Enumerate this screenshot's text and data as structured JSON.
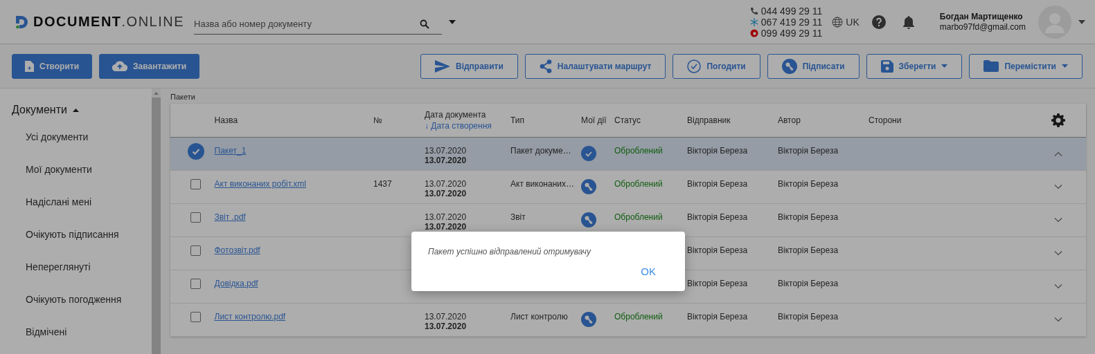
{
  "header": {
    "logo": {
      "bold": "DOCUMENT",
      "light": ".ONLINE"
    },
    "search": {
      "placeholder": "Назва або номер документу"
    },
    "phones": [
      "044 499 29 11",
      "067 419 29 11",
      "099 499 29 11"
    ],
    "language": "UK",
    "user": {
      "name": "Богдан Мартищенко",
      "email": "marbo97fd@gmail.com"
    }
  },
  "toolbar": {
    "buttons": [
      {
        "label": "Створити",
        "kind": "primary",
        "dropdown": false
      },
      {
        "label": "Завантажити",
        "kind": "primary",
        "dropdown": false
      },
      {
        "label": "Відправити",
        "kind": "outline",
        "dropdown": false
      },
      {
        "label": "Налаштувати маршрут",
        "kind": "outline",
        "dropdown": false
      },
      {
        "label": "Погодити",
        "kind": "outline",
        "dropdown": false
      },
      {
        "label": "Підписати",
        "kind": "outline",
        "dropdown": false
      },
      {
        "label": "Зберегти",
        "kind": "outline",
        "dropdown": true
      },
      {
        "label": "Перемістити",
        "kind": "outline",
        "dropdown": true
      }
    ]
  },
  "sidebar": {
    "title": "Документи",
    "expanded": true,
    "items": [
      {
        "label": "Усі документи"
      },
      {
        "label": "Мої документи"
      },
      {
        "label": "Надіслані мені"
      },
      {
        "label": "Очікують підписання"
      },
      {
        "label": "Непереглянуті"
      },
      {
        "label": "Очікують погодження"
      },
      {
        "label": "Відмічені"
      }
    ]
  },
  "breadcrumb": "Пакети",
  "table": {
    "columns": [
      "Назва",
      "№",
      "Дата документа",
      "Тип",
      "Мої дії",
      "Статус",
      "Відправник",
      "Автор",
      "Сторони"
    ],
    "sort_label": "↓ Дата створення",
    "rows": [
      {
        "selected": true,
        "expanded": true,
        "name": "Пакет_1",
        "date_doc": "13.07.2020",
        "date_created": "13.07.2020",
        "type": "Пакет докуме…",
        "action": {
          "kind": "approve"
        },
        "status": "Оброблений",
        "sender": "Вікторія Береза",
        "author": "Вікторія Береза"
      },
      {
        "selected": false,
        "expanded": false,
        "name": "Акт виконаних робіт.xml",
        "number": "1437",
        "date_doc": "13.07.2020",
        "date_created": "13.07.2020",
        "type": "Акт виконаних…",
        "action": {
          "kind": "sign"
        },
        "status": "Оброблений",
        "sender": "Вікторія Береза",
        "author": "Вікторія Береза"
      },
      {
        "selected": false,
        "expanded": false,
        "name": "Звіт .pdf",
        "date_doc": "13.07.2020",
        "date_created": "13.07.2020",
        "type": "Звіт",
        "action": {
          "kind": "sign"
        },
        "status": "Оброблений",
        "sender": "Вікторія Береза",
        "author": "Вікторія Береза"
      },
      {
        "selected": false,
        "expanded": false,
        "name": "Фотозвіт.pdf",
        "sender": "Вікторія Береза",
        "author": "Вікторія Береза"
      },
      {
        "selected": false,
        "expanded": false,
        "name": "Довідка.pdf",
        "sender": "Вікторія Береза",
        "author": "Вікторія Береза"
      },
      {
        "selected": false,
        "expanded": false,
        "name": "Лист контролю.pdf",
        "date_doc": "13.07.2020",
        "date_created": "13.07.2020",
        "type": "Лист контролю",
        "action": {
          "kind": "sign"
        },
        "status": "Оброблений",
        "sender": "Вікторія Береза",
        "author": "Вікторія Береза"
      }
    ]
  },
  "dialog": {
    "message": "Пакет успішно відправлений отримувачу",
    "button": "OK"
  }
}
